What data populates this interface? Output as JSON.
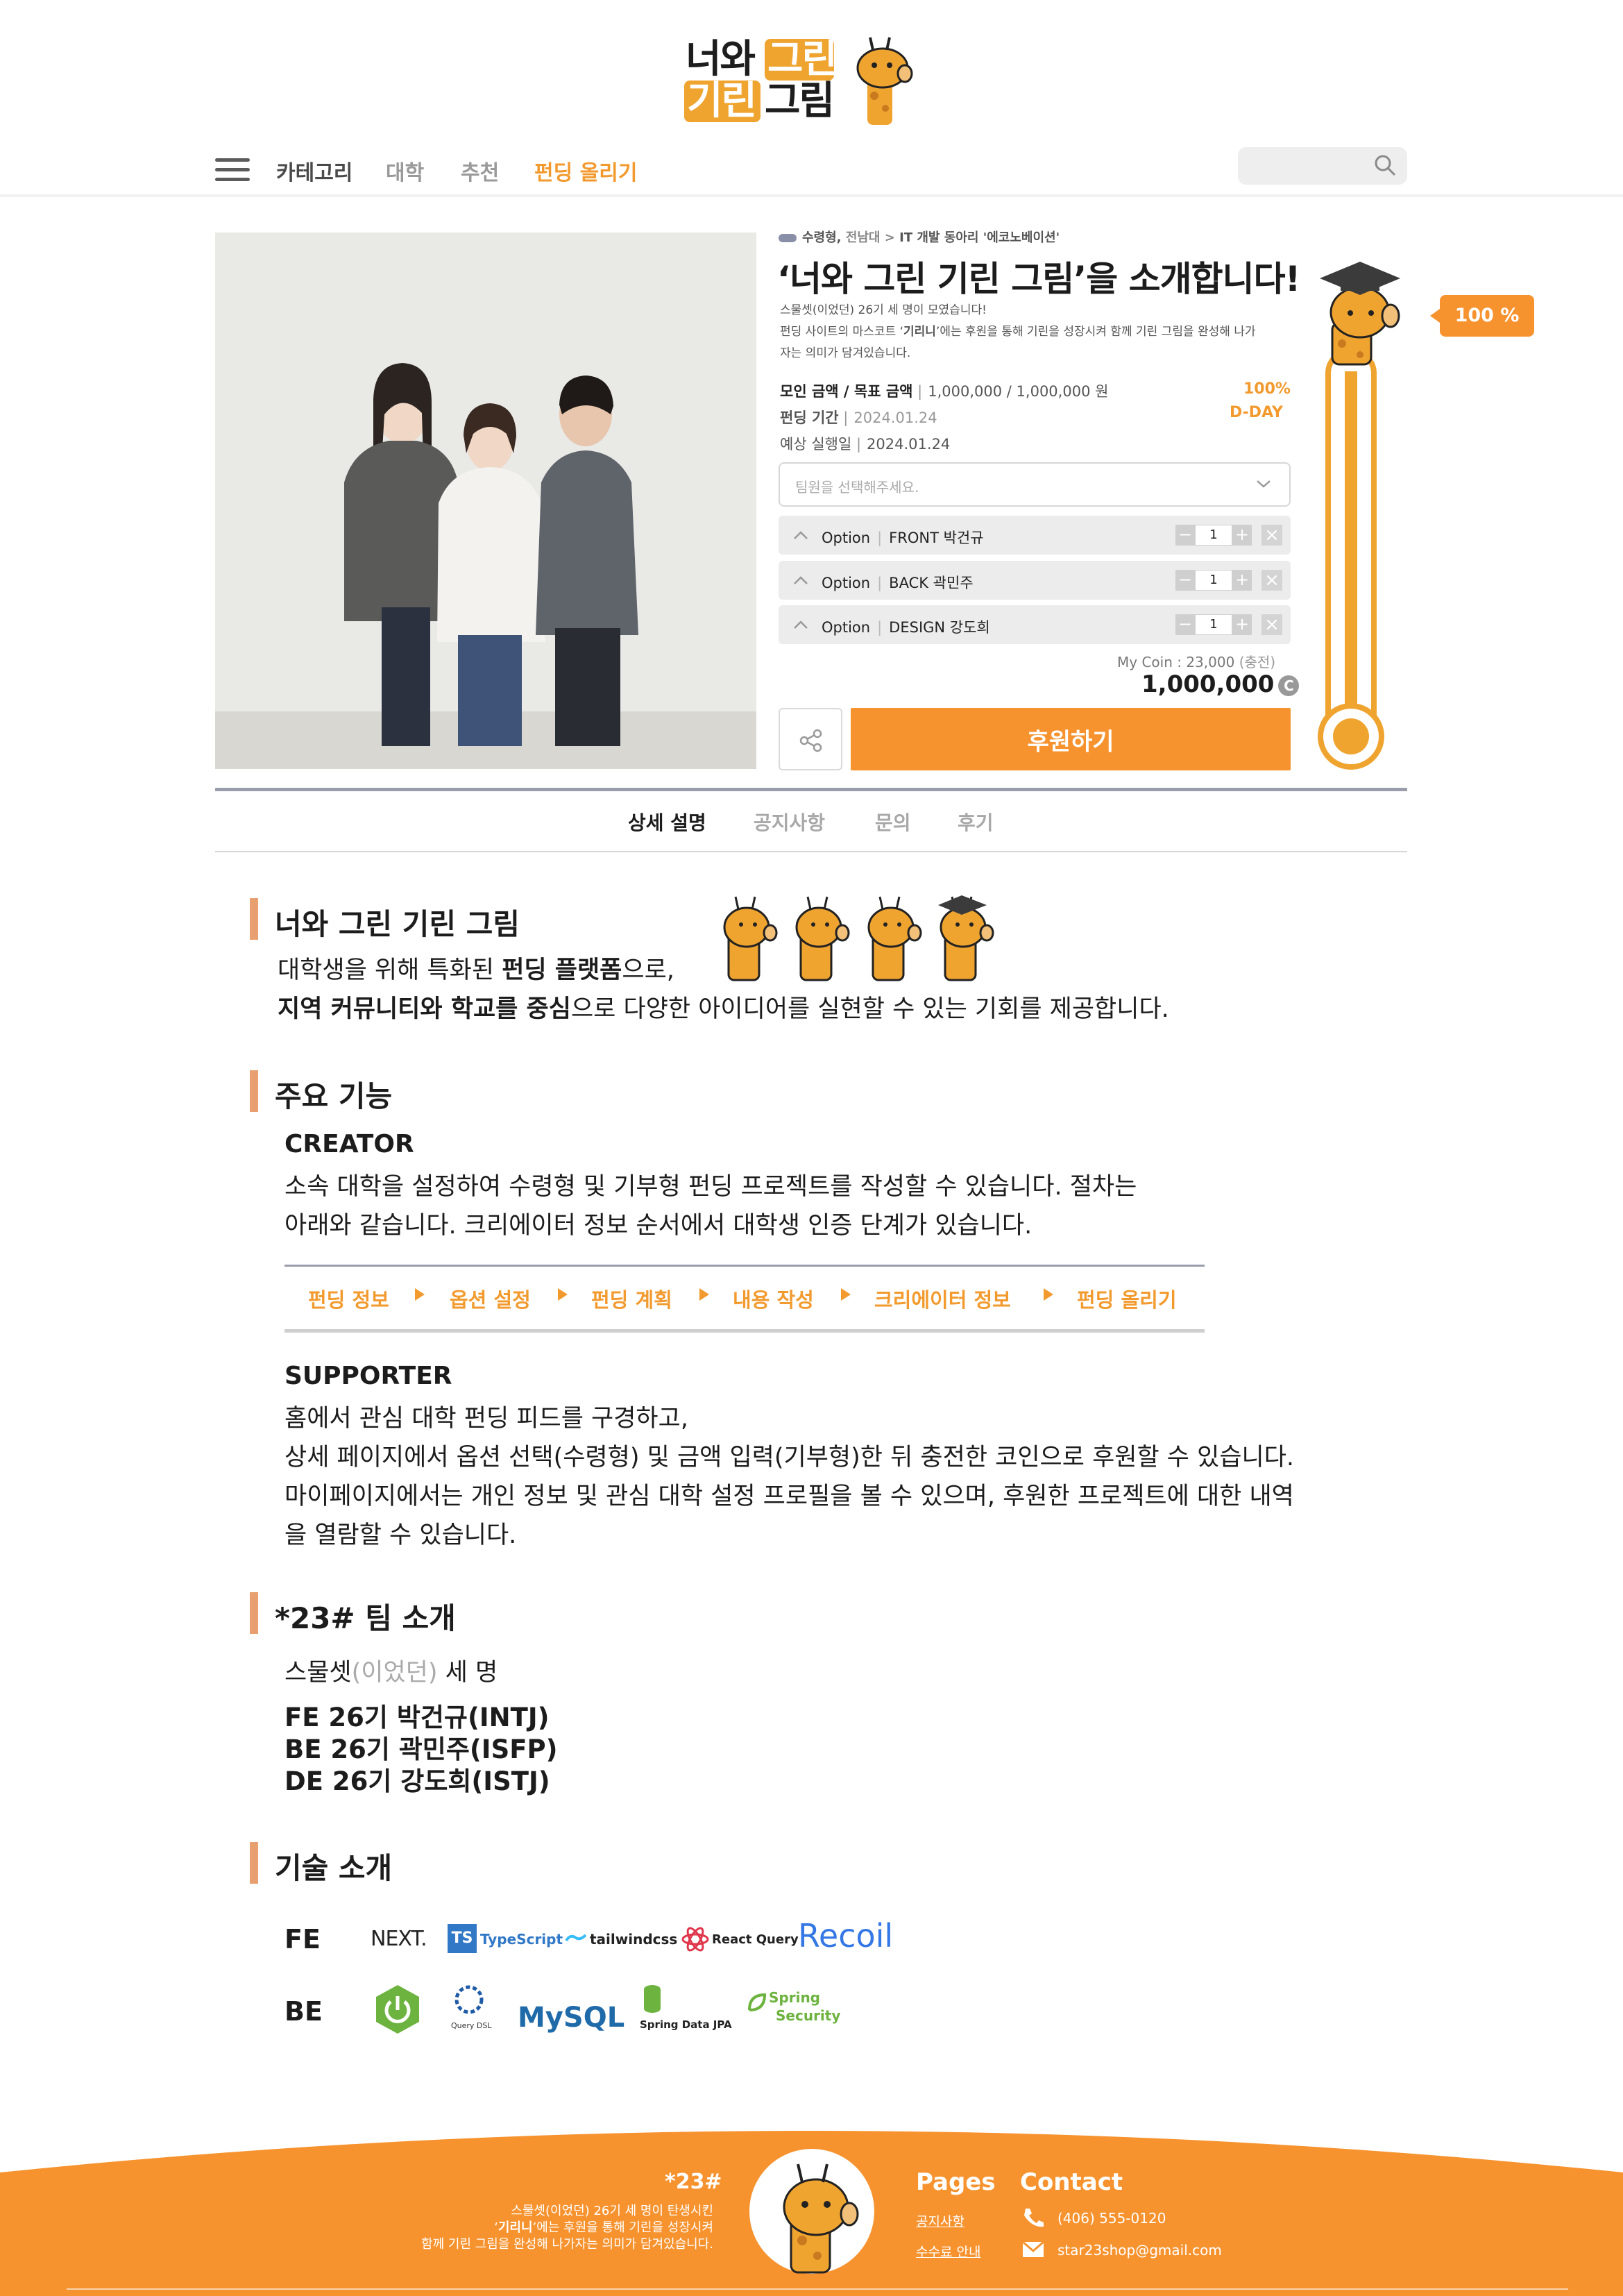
{
  "header": {
    "logo": {
      "line1_a": "너와",
      "line1_b": "그린",
      "line2_a": "기린",
      "line2_b": "그림"
    },
    "nav": {
      "menu_icon": "hamburger-icon",
      "category": "카테고리",
      "university": "대학",
      "recommend": "추천",
      "upload": "펀딩 올리기"
    },
    "search": {
      "placeholder": "",
      "icon": "search-icon"
    }
  },
  "product": {
    "breadcrumb": {
      "type": "수령형,",
      "school": "전남대 >",
      "club": "IT 개발 동아리 '에코노베이션'"
    },
    "title": "‘너와 그린 기린 그림’을 소개합니다!",
    "desc_line1": "스물셋(이었던) 26기 세 명이 모였습니다!",
    "desc_line2_a": "펀딩 사이트의 마스코트 ‘",
    "desc_line2_b": "기리니",
    "desc_line2_c": "’에는 후원을 통해 기린을 성장시켜 함께 기린 그림을 완성해 나가",
    "desc_line3": "자는 의미가 담겨있습니다.",
    "amount_label": "모인 금액 / 목표 금액",
    "amount_value": "1,000,000 / 1,000,000 원",
    "period_label": "펀딩 기간",
    "period_value": "2024.01.24",
    "delivery_label": "예상 실행일",
    "delivery_value": "2024.01.24",
    "percent": "100%",
    "dday": "D-DAY",
    "member_select_placeholder": "팀원을 선택해주세요.",
    "options": [
      {
        "label": "Option",
        "member": "FRONT 박건규",
        "qty": "1"
      },
      {
        "label": "Option",
        "member": "BACK 곽민주",
        "qty": "1"
      },
      {
        "label": "Option",
        "member": "DESIGN 강도희",
        "qty": "1"
      }
    ],
    "coin_label": "My Coin : 23,000",
    "coin_charge": "(충전)",
    "total": "1,000,000",
    "coin_symbol": "C",
    "support_button": "후원하기",
    "progress_fraction": 1.0,
    "progress_bubble": "100 %"
  },
  "tabs": [
    "상세 설명",
    "공지사항",
    "문의",
    "후기"
  ],
  "content": {
    "intro_title": "너와 그린 기린 그림",
    "intro_l1_a": "대학생을 위해 특화된 ",
    "intro_l1_b": "펀딩 플랫폼",
    "intro_l1_c": "으로,",
    "intro_l2_a": "지역 커뮤니티와 학교를 중심",
    "intro_l2_b": "으로 다양한 아이디어를 실현할 수 있는 기회를 제공합니다.",
    "features_title": "주요 기능",
    "creator_title": "CREATOR",
    "creator_l1": "소속 대학을 설정하여 수령형 및 기부형 펀딩 프로젝트를 작성할 수 있습니다. 절차는",
    "creator_l2": "아래와 같습니다. 크리에이터 정보 순서에서 대학생 인증 단계가 있습니다.",
    "steps": [
      "펀딩 정보",
      "옵션 설정",
      "펀딩 계획",
      "내용 작성",
      "크리에이터 정보",
      "펀딩 올리기"
    ],
    "supporter_title": "SUPPORTER",
    "supporter_l1": "홈에서 관심 대학 펀딩 피드를 구경하고,",
    "supporter_l2": "상세 페이지에서 옵션 선택(수령형) 및 금액 입력(기부형)한 뒤 충전한 코인으로 후원할 수 있습니다.",
    "supporter_l3": "마이페이지에서는 개인 정보 및 관심 대학 설정 프로필을 볼 수 있으며, 후원한 프로젝트에 대한 내역",
    "supporter_l4": "을 열람할 수 있습니다.",
    "team_title": "*23# 팀 소개",
    "team_intro_a": "스물셋",
    "team_intro_b": "(이었던)",
    "team_intro_c": " 세 명",
    "members": [
      "FE 26기 박건규(INTJ)",
      "BE 26기 곽민주(ISFP)",
      "DE 26기 강도희(ISTJ)"
    ],
    "tech_title": "기술 소개",
    "fe_label": "FE",
    "be_label": "BE",
    "fe_stack": [
      "NEXT.",
      "TS",
      "TypeScript",
      "tailwindcss",
      "React Query",
      "Recoil"
    ],
    "be_stack": [
      "Query DSL",
      "MySQL",
      "Spring Data JPA",
      "Spring",
      "Security"
    ]
  },
  "footer": {
    "brand": "*23#",
    "desc_l1": "스물셋(이었던) 26기 세 명이 탄생시킨",
    "desc_l2_a": "‘",
    "desc_l2_b": "기리니",
    "desc_l2_c": "’에는 후원을 통해 기린을 성장시켜",
    "desc_l3": "함께 기린 그림을 완성해 나가자는 의미가 담겨있습니다.",
    "pages_title": "Pages",
    "pages": [
      "공지사항",
      "수수료 안내"
    ],
    "contact_title": "Contact",
    "phone": "(406) 555-0120",
    "email": "star23shop@gmail.com"
  },
  "colors": {
    "brand_orange": "#f7932f",
    "accent_text": "#f29a2e",
    "logo_yellow": "#f0a430",
    "section_bar": "#e8a070"
  }
}
